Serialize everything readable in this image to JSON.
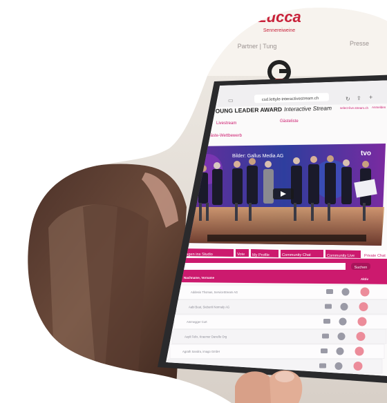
{
  "background": {
    "logo_text": "Lucca",
    "logo_subtext": "Sennereiweine",
    "sign_left": "Partner | Tung",
    "sign_right": "Presse"
  },
  "browser": {
    "url": "csd.lettyle-interactivestream.ch"
  },
  "site": {
    "title_bold": "YOUNG LEADER AWARD",
    "title_rest": "Interactive Stream",
    "top_links": [
      "select-live.stream.ch",
      "Anmelden"
    ],
    "nav": {
      "livestream": "Livestream",
      "gaesteliste": "Gästeliste",
      "wettbewerb": "Gäste-Wettbewerb"
    },
    "video": {
      "caption": "Bilder: Gallus Media AG",
      "corner_logo": "tvo"
    },
    "tabs": [
      "Fragen ins Studio",
      "Vote",
      "My Profile",
      "Community Chat",
      "Community Live",
      "Private Chat"
    ],
    "active_tab": "Private Chat",
    "search": {
      "button": "Suchen",
      "placeholder": ""
    },
    "table": {
      "header": "Nachname, Vorname",
      "header_right": "Aktiv",
      "rows": [
        "Addesio Thomas, ServiceStream AG",
        "Aabi Beat, Siebenli Normaly AG",
        "Ammegger Curt",
        "Aepli Felix, Kraemer Danelle Org",
        "Agrath Sandra, imago GmbH",
        "Ahern Paul, Axelrod AG"
      ]
    }
  },
  "colors": {
    "accent": "#cc1a6e",
    "accent_dark": "#a8145a",
    "stage_purple": "#5a2a8a",
    "tablet_frame": "#2a2a2c"
  }
}
